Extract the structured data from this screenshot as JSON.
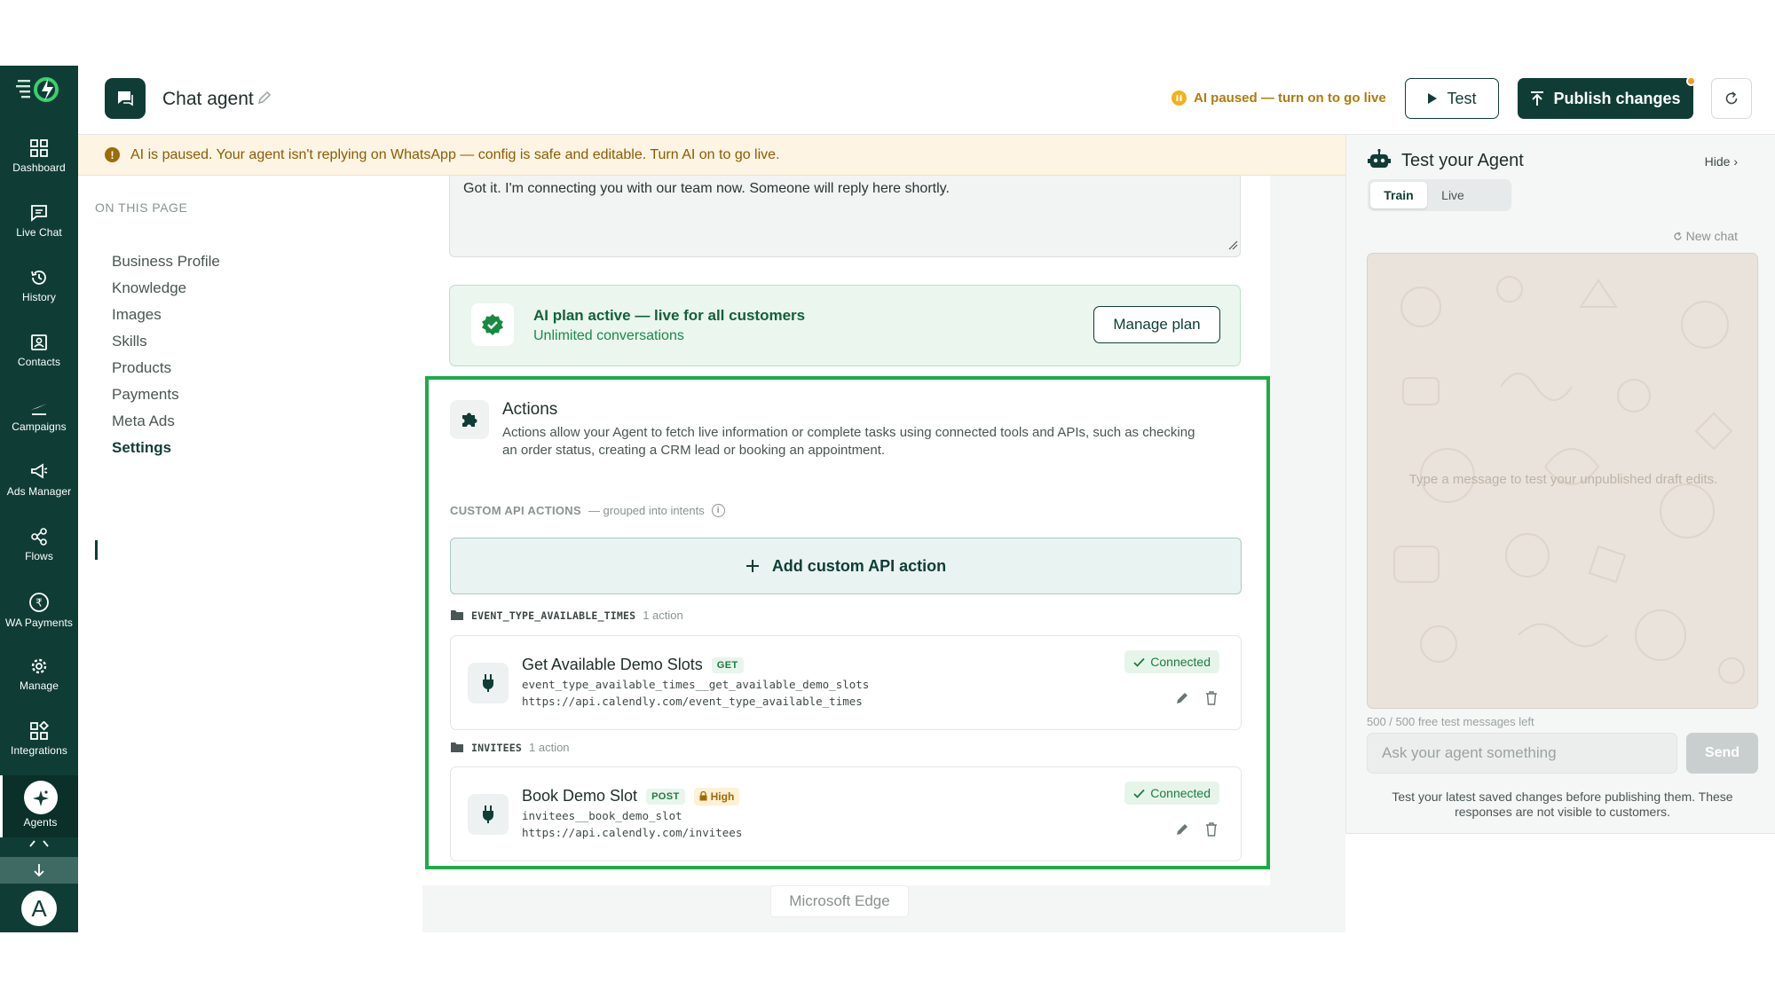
{
  "rail": {
    "items": [
      {
        "label": "Dashboard",
        "icon": "dashboard-icon"
      },
      {
        "label": "Live Chat",
        "icon": "chat-icon"
      },
      {
        "label": "History",
        "icon": "history-icon"
      },
      {
        "label": "Contacts",
        "icon": "contacts-icon"
      },
      {
        "label": "Campaigns",
        "icon": "campaigns-icon"
      },
      {
        "label": "Ads Manager",
        "icon": "megaphone-icon"
      },
      {
        "label": "Flows",
        "icon": "flows-icon"
      },
      {
        "label": "WA Payments",
        "icon": "rupee-icon"
      },
      {
        "label": "Manage",
        "icon": "gear-icon"
      },
      {
        "label": "Integrations",
        "icon": "integrations-icon"
      },
      {
        "label": "Agents",
        "icon": "sparkle-icon"
      }
    ],
    "avatar_initial": "A"
  },
  "header": {
    "title": "Chat agent",
    "paused_status": "AI paused — turn on to go live",
    "test_label": "Test",
    "publish_label": "Publish changes"
  },
  "banner": {
    "text": "AI is paused. Your agent isn't replying on WhatsApp — config is safe and editable. Turn AI on to go live.",
    "icon_glyph": "!"
  },
  "on_this_page": {
    "heading": "ON THIS PAGE",
    "items": [
      "Business Profile",
      "Knowledge",
      "Images",
      "Skills",
      "Products",
      "Payments",
      "Meta Ads",
      "Settings"
    ],
    "active": "Settings"
  },
  "reply_box": {
    "text": "Got it. I'm connecting you with our team now. Someone will reply here shortly."
  },
  "plan": {
    "title": "AI plan active — live for all customers",
    "subtitle": "Unlimited conversations",
    "manage_label": "Manage plan"
  },
  "actions": {
    "title": "Actions",
    "description": "Actions allow your Agent to fetch live information or complete tasks using connected tools and APIs, such as checking an order status, creating a CRM lead or booking an appointment.",
    "custom_heading": "CUSTOM API ACTIONS",
    "custom_sub": "— grouped into intents",
    "add_label": "Add custom API action",
    "groups": [
      {
        "name": "EVENT_TYPE_AVAILABLE_TIMES",
        "count": "1 action",
        "action": {
          "name": "Get Available Demo Slots",
          "method": "GET",
          "slug": "event_type_available_times__get_available_demo_slots",
          "url": "https://api.calendly.com/event_type_available_times",
          "status": "Connected"
        }
      },
      {
        "name": "INVITEES",
        "count": "1 action",
        "action": {
          "name": "Book Demo Slot",
          "method": "POST",
          "risk": "High",
          "slug": "invitees__book_demo_slot",
          "url": "https://api.calendly.com/invitees",
          "status": "Connected"
        }
      }
    ]
  },
  "edge_label": "Microsoft Edge",
  "test_panel": {
    "title": "Test your Agent",
    "hide_label": "Hide ›",
    "tabs": [
      "Train",
      "Live"
    ],
    "active_tab": "Train",
    "new_chat_label": "New chat",
    "chat_placeholder": "Type a message to test your unpublished draft edits.",
    "quota": "500 / 500 free test messages left",
    "input_placeholder": "Ask your agent something",
    "send_label": "Send",
    "note": "Test your latest saved changes before publishing them. These responses are not visible to customers."
  },
  "colors": {
    "brand": "#0f3d36",
    "highlight_border": "#1faa4a",
    "banner_bg": "#fdf4e3",
    "paused": "#f1b21a",
    "connected": "#1b7c44"
  }
}
